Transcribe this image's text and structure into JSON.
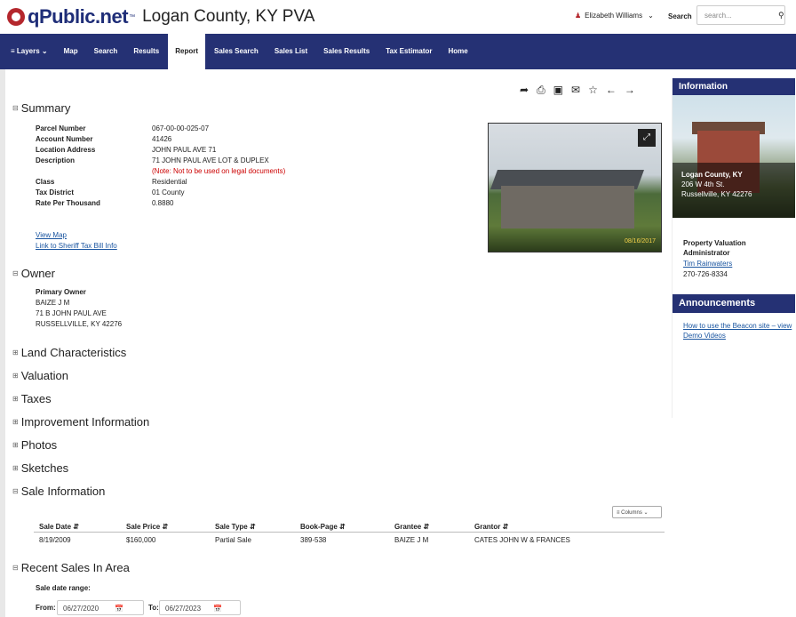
{
  "header": {
    "brand": "qPublic.net",
    "trademark": "™",
    "county": "Logan County, KY PVA",
    "user_name": "Elizabeth Williams",
    "search_label": "Search",
    "search_placeholder": "search..."
  },
  "nav": {
    "layers": "Layers",
    "map": "Map",
    "search": "Search",
    "results": "Results",
    "report": "Report",
    "sales_search": "Sales Search",
    "sales_list": "Sales List",
    "sales_results": "Sales Results",
    "tax_estimator": "Tax Estimator",
    "home": "Home"
  },
  "summary": {
    "title": "Summary",
    "parcel_label": "Parcel Number",
    "parcel": "067-00-00-025-07",
    "account_label": "Account Number",
    "account": "41426",
    "location_label": "Location Address",
    "location": "JOHN PAUL AVE 71",
    "desc_label": "Description",
    "desc": "71 JOHN PAUL AVE LOT & DUPLEX",
    "desc_note": "(Note: Not to be used on legal documents)",
    "class_label": "Class",
    "class": "Residential",
    "district_label": "Tax District",
    "district": "01 County",
    "rate_label": "Rate Per Thousand",
    "rate": "0.8880",
    "view_map": "View Map",
    "sheriff_link": "Link to Sheriff Tax Bill Info",
    "photo_date": "08/16/2017"
  },
  "owner": {
    "title": "Owner",
    "primary_label": "Primary Owner",
    "name": "BAIZE J M",
    "addr1": "71 B JOHN PAUL AVE",
    "addr2": "RUSSELLVILLE, KY 42276"
  },
  "sections": {
    "land": "Land Characteristics",
    "valuation": "Valuation",
    "taxes": "Taxes",
    "improvement": "Improvement Information",
    "photos": "Photos",
    "sketches": "Sketches",
    "sale_info": "Sale Information",
    "recent_sales": "Recent Sales In Area"
  },
  "sales": {
    "columns_btn": "Columns",
    "headers": [
      "Sale Date",
      "Sale Price",
      "Sale Type",
      "Book-Page",
      "Grantee",
      "Grantor"
    ],
    "row": [
      "8/19/2009",
      "$160,000",
      "Partial Sale",
      "389-538",
      "BAIZE J M",
      "CATES JOHN W & FRANCES"
    ]
  },
  "recent": {
    "range_label": "Sale date range:",
    "from_label": "From:",
    "from": "06/27/2020",
    "to_label": "To:",
    "to": "06/27/2023"
  },
  "info": {
    "title": "Information",
    "cap1": "Logan County, KY",
    "cap2": "206 W 4th St.",
    "cap3": "Russellville, KY 42276",
    "pva1": "Property Valuation",
    "pva2": "Administrator",
    "admin": "Tim Rainwaters",
    "phone": "270-726-8334",
    "ann_title": "Announcements",
    "ann_link1": "How to use the Beacon site – view",
    "ann_link2": "Demo Videos"
  },
  "colors": {
    "nav": "#253174",
    "brand_red": "#b4272d",
    "link": "#1a55a0"
  }
}
